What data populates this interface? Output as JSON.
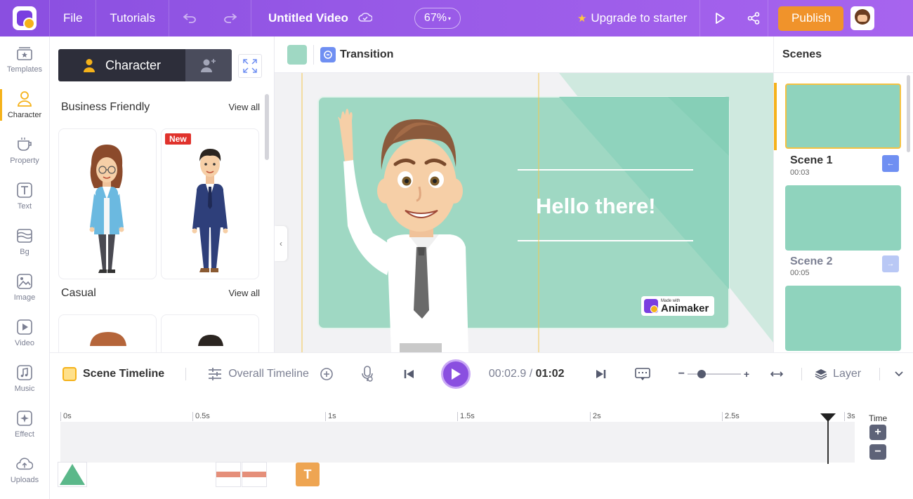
{
  "topbar": {
    "file": "File",
    "tutorials": "Tutorials",
    "project_title": "Untitled Video",
    "zoom": "67%",
    "upgrade": "Upgrade to starter",
    "publish": "Publish",
    "colors": {
      "bar_start": "#8a4fe0",
      "bar_end": "#a764ee",
      "publish_bg": "#f0932b"
    }
  },
  "sidebar": {
    "items": [
      {
        "label": "Templates",
        "icon": "templates-icon"
      },
      {
        "label": "Character",
        "icon": "character-icon",
        "active": true
      },
      {
        "label": "Property",
        "icon": "property-icon"
      },
      {
        "label": "Text",
        "icon": "text-icon"
      },
      {
        "label": "Bg",
        "icon": "background-icon"
      },
      {
        "label": "Image",
        "icon": "image-icon"
      },
      {
        "label": "Video",
        "icon": "video-icon"
      },
      {
        "label": "Music",
        "icon": "music-icon"
      },
      {
        "label": "Effect",
        "icon": "effect-icon"
      },
      {
        "label": "Uploads",
        "icon": "uploads-icon"
      }
    ]
  },
  "character_panel": {
    "tab_label": "Character",
    "sections": [
      {
        "title": "Business Friendly",
        "view_all": "View all",
        "new_badge": "New"
      },
      {
        "title": "Casual",
        "view_all": "View all"
      }
    ]
  },
  "canvas": {
    "transition_label": "Transition",
    "headline": "Hello there!",
    "watermark_small": "Made with",
    "watermark_brand": "Animaker",
    "scene_color": "#9fd8c3"
  },
  "scenes": {
    "title": "Scenes",
    "items": [
      {
        "name": "Scene 1",
        "duration": "00:03"
      },
      {
        "name": "Scene 2",
        "duration": "00:05"
      }
    ]
  },
  "timeline": {
    "scene_timeline": "Scene Timeline",
    "overall_timeline": "Overall Timeline",
    "current_time": "00:02.9",
    "total_time": "01:02",
    "layer": "Layer",
    "time_label": "Time",
    "ticks": [
      "0s",
      "0.5s",
      "1s",
      "1.5s",
      "2s",
      "2.5s",
      "3s"
    ],
    "text_item": "T"
  }
}
